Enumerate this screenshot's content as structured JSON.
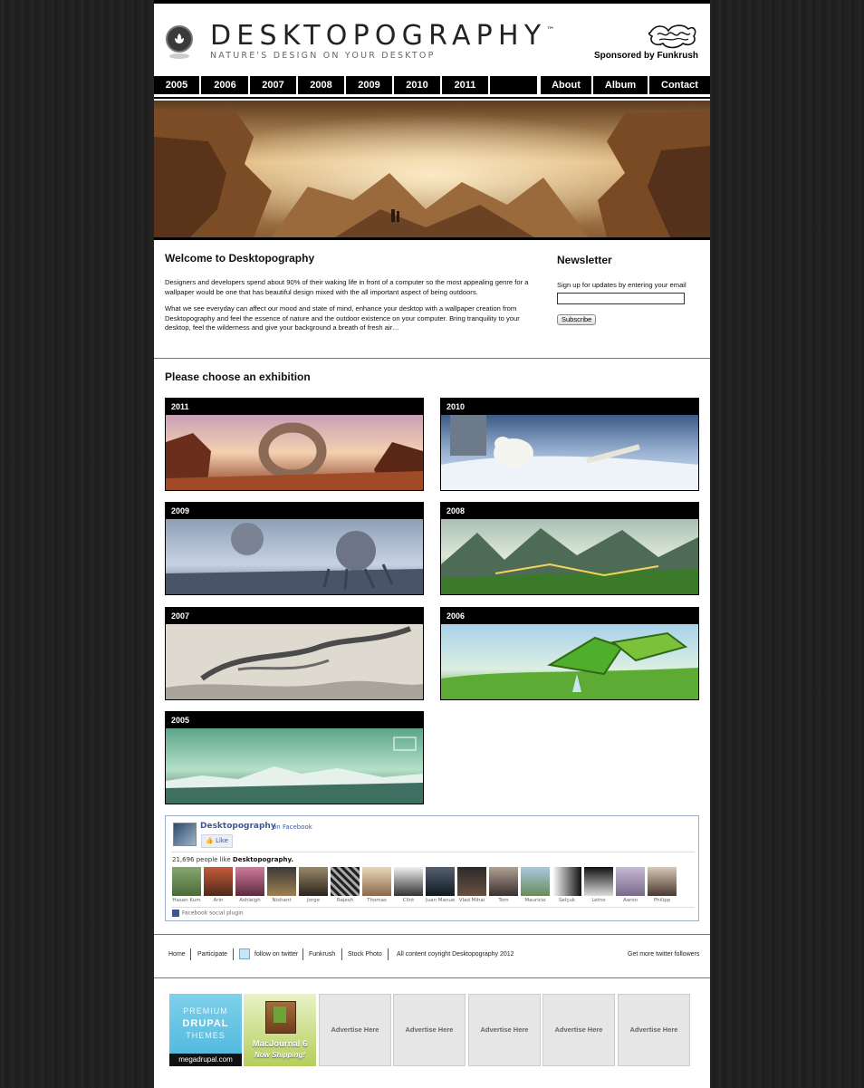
{
  "site": {
    "brand": "DESKTOPOGRAPHY",
    "trademark": "™",
    "tagline": "NATURE'S DESIGN ON YOUR DESKTOP",
    "sponsor": "Sponsored by Funkrush"
  },
  "nav": {
    "years": [
      "2005",
      "2006",
      "2007",
      "2008",
      "2009",
      "2010",
      "2011"
    ],
    "pages": [
      "About",
      "Album",
      "Contact"
    ]
  },
  "welcome": {
    "title": "Welcome to Desktopography",
    "p1": "Designers and developers spend about 90% of their waking life in front of a computer so the most appealing genre for a wallpaper would be one that has beautiful design mixed with the all important aspect of being outdoors.",
    "p2": "What we see everyday can affect our mood and state of mind, enhance your desktop with a wallpaper creation from Desktopography and feel the essence of nature and the outdoor existence on your computer. Bring tranquility to your desktop, feel the wilderness and give your background a breath of fresh air…"
  },
  "newsletter": {
    "title": "Newsletter",
    "text": "Sign up for updates by entering your email",
    "input_value": "",
    "button": "Subscribe"
  },
  "exhibitions": {
    "title": "Please choose an exhibition",
    "items": [
      "2011",
      "2010",
      "2009",
      "2008",
      "2007",
      "2006",
      "2005"
    ]
  },
  "facebook": {
    "page_name": "Desktopography",
    "on_facebook": "on Facebook",
    "like": "Like",
    "count_text": "21,696 people like",
    "count_page": "Desktopography.",
    "people": [
      "Hasan Kum",
      "Arin",
      "Ashleigh",
      "Nishant",
      "Jorge",
      "Rajesh",
      "Thomas",
      "Clint",
      "Juan Manue",
      "Vlad Mihai",
      "Tom",
      "Maurício",
      "Selçuk",
      "Letno",
      "Aaron",
      "Philipp"
    ],
    "plugin": "Facebook social plugin"
  },
  "footer": {
    "home": "Home",
    "participate": "Participate",
    "twitter": "follow on twitter",
    "funkrush": "Funkrush",
    "stock": "Stock Photo",
    "copyright": "All content coyright Desktopography 2012",
    "followers": "Get more twitter followers"
  },
  "ads": {
    "drupal_l1": "PREMIUM",
    "drupal_l2": "DRUPAL",
    "drupal_l3": "THEMES",
    "drupal_site": "megadrupal.com",
    "mac_l1": "MacJournal 6",
    "mac_l2": "Now Shipping!",
    "placeholder": "Advertise Here"
  },
  "colors": {
    "page_bg": "#222222",
    "nav_bg": "#000000",
    "facebook_blue": "#3b5998"
  }
}
